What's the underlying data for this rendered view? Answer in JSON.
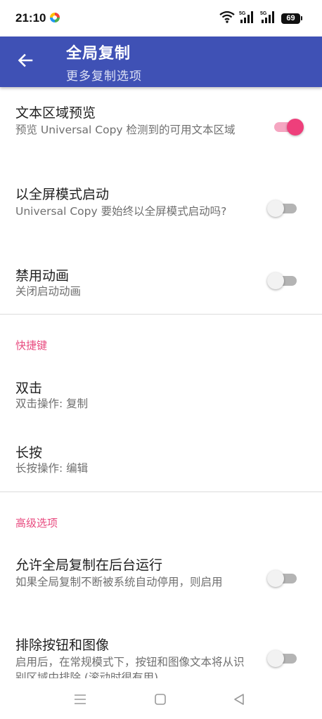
{
  "status_bar": {
    "time": "21:10",
    "battery": "69",
    "icons": [
      "app-notification-icon",
      "wifi-icon",
      "5g-signal-icon",
      "5g-signal-icon",
      "battery-icon"
    ]
  },
  "app_bar": {
    "title": "全局复制",
    "subtitle": "更多复制选项",
    "back_icon": "arrow-back-icon",
    "color": "#3f51b5"
  },
  "sections": {
    "general": {
      "items": [
        {
          "title": "文本区域预览",
          "summary": "预览 Universal Copy 检测到的可用文本区域",
          "enabled": true
        },
        {
          "title": "以全屏模式启动",
          "summary": "Universal Copy 要始终以全屏模式启动吗?",
          "enabled": false
        },
        {
          "title": "禁用动画",
          "summary": "关闭启动动画",
          "enabled": false
        }
      ]
    },
    "shortcuts": {
      "header": "快捷键",
      "items": [
        {
          "title": "双击",
          "summary": "双击操作: 复制"
        },
        {
          "title": "长按",
          "summary": "长按操作: 编辑"
        }
      ]
    },
    "advanced": {
      "header": "高级选项",
      "items": [
        {
          "title": "允许全局复制在后台运行",
          "summary": "如果全局复制不断被系统自动停用，则启用",
          "enabled": false
        },
        {
          "title": "排除按钮和图像",
          "summary": "启用后，在常规模式下，按钮和图像文本将从识别区域中排除 (滚动时很有用)",
          "enabled": false
        }
      ]
    }
  },
  "colors": {
    "accent": "#ee3f7b",
    "category_header": "#e84a7f",
    "summary_text": "#6f6f6f"
  },
  "nav_bar": {
    "icons": [
      "menu-icon",
      "home-icon",
      "back-triangle-icon"
    ]
  }
}
